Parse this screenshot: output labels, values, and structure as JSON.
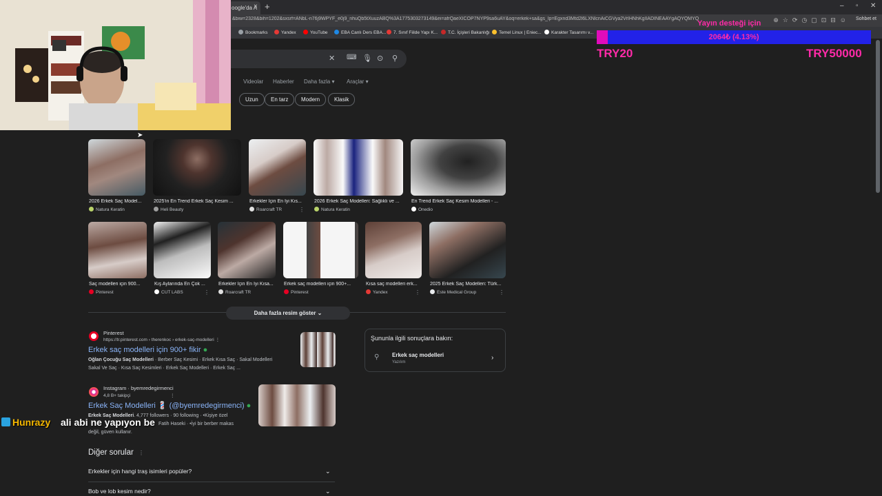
{
  "browser": {
    "tab_title": "oogle'da A",
    "url": "&biw=2328&bih=1202&sxsrf=ANbL-n76j9WPYF_e0j9_nhuQb5tXuuzABQ%3A1775303273149&ei=afrQaeXICOP7NYP9sa6uAY&oq=erkek+sa&gs_lp=Egxnd3Mtd2l6LXNlcnAiCGVya2VrIHNhKgIIADINEAAYgAQYQMYQ",
    "profile_label": "Sohbet et",
    "bookmarks": [
      {
        "label": "Bookmarks",
        "color": "#9aa0a6"
      },
      {
        "label": "Yandex",
        "color": "#e53935"
      },
      {
        "label": "YouTube",
        "color": "#ff0000"
      },
      {
        "label": "EBA Canlı Ders EBA...",
        "color": "#1e88e5"
      },
      {
        "label": "7. Sınıf Fiilde Yapı K...",
        "color": "#e53935"
      },
      {
        "label": "T.C. İçişleri Bakanlığı",
        "color": "#c62828"
      },
      {
        "label": "Temel Linux | Eniec...",
        "color": "#fbc02d"
      },
      {
        "label": "Karakter Tasarımı v...",
        "color": "#ffffff"
      }
    ]
  },
  "search": {
    "tabs": [
      "Videolar",
      "Haberler",
      "Daha fazla",
      "Araçlar"
    ],
    "chips": [
      "Uzun",
      "En tarz",
      "Modern",
      "Klasik"
    ]
  },
  "images": {
    "row1": [
      {
        "caption": "2026 Erkek Saç Model...",
        "source": "Natura Keratin",
        "color": "#b9d36a"
      },
      {
        "caption": "2025'in En Trend Erkek Saç Kesim ...",
        "source": "Heli Beauty",
        "color": "#9e9e9e"
      },
      {
        "caption": "Erkekler İçin En İyi Kıs...",
        "source": "Roarcraft TR",
        "color": "#e0e0e0"
      },
      {
        "caption": "2026 Erkek Saç Modelleri: Sağlıklı ve ...",
        "source": "Natura Keratin",
        "color": "#b9d36a"
      },
      {
        "caption": "En Trend Erkek Saç Kesim Modelleri - ...",
        "source": "Onedio",
        "color": "#ffffff"
      }
    ],
    "row2": [
      {
        "caption": "Saç modelleri için 900...",
        "source": "Pinterest",
        "color": "#e60023"
      },
      {
        "caption": "Kış Aylarında En Çok ...",
        "source": "CUT LABS",
        "color": "#ffffff"
      },
      {
        "caption": "Erkekler İçin En İyi Kısa...",
        "source": "Roarcraft TR",
        "color": "#e0e0e0"
      },
      {
        "caption": "Erkek saç modelleri için 900+...",
        "source": "Pinterest",
        "color": "#e60023"
      },
      {
        "caption": "Kısa saç modelleri erk...",
        "source": "Yandex",
        "color": "#e53935"
      },
      {
        "caption": "2025 Erkek Saç Modelleri: Türk...",
        "source": "Este Medical Group",
        "color": "#e8eaed"
      }
    ],
    "more_label": "Daha fazla resim göster"
  },
  "results": [
    {
      "site": "Pinterest",
      "crumb": "https://tr.pinterest.com › therenkoc › erkek-saç-modelleri",
      "title": "Erkek saç modelleri için 900+ fikir",
      "snippet_bold": "Oğlan Çocuğu Saç Modelleri",
      "snippet": " · Berber Saç Kesimi · Erkek Kısa Saç · Sakal Modelleri",
      "snippet2": "Sakal Ve Saç · Kısa Saç Kesimleri · Erkek Saç Modelleri · Erkek Saç ..."
    },
    {
      "site": "Instagram · byemredegirmenci",
      "crumb": "4,8 B+ takipçi",
      "title": "Erkek Saç Modelleri 💈 (@byemredegirmenci)",
      "snippet_bold": "Erkek Saç Modelleri",
      "snippet": ". 4,777 followers · 90 following · •Kişiye özel",
      "snippet2": "Fatih Haseki · •İyi bir berber makas",
      "snippet3": "değil, güven kullanır."
    }
  ],
  "related": {
    "heading": "Şununla ilgili sonuçlara bakın:",
    "item": "Erkek saç modelleri",
    "item_sub": "Yazılım"
  },
  "questions": {
    "heading": "Diğer sorular",
    "items": [
      "Erkekler için hangi traş isimleri popüler?",
      "Bob ve lob kesim nedir?"
    ]
  },
  "overlay": {
    "donation_title": "Yayın desteği için",
    "donation_amount": "2064₺ (4.13%)",
    "min_label": "TRY20",
    "max_label": "TRY50000",
    "donation_fraction": 0.0413,
    "chat_user": "Hunrazy",
    "chat_message": "ali abi ne yapıyon be"
  }
}
